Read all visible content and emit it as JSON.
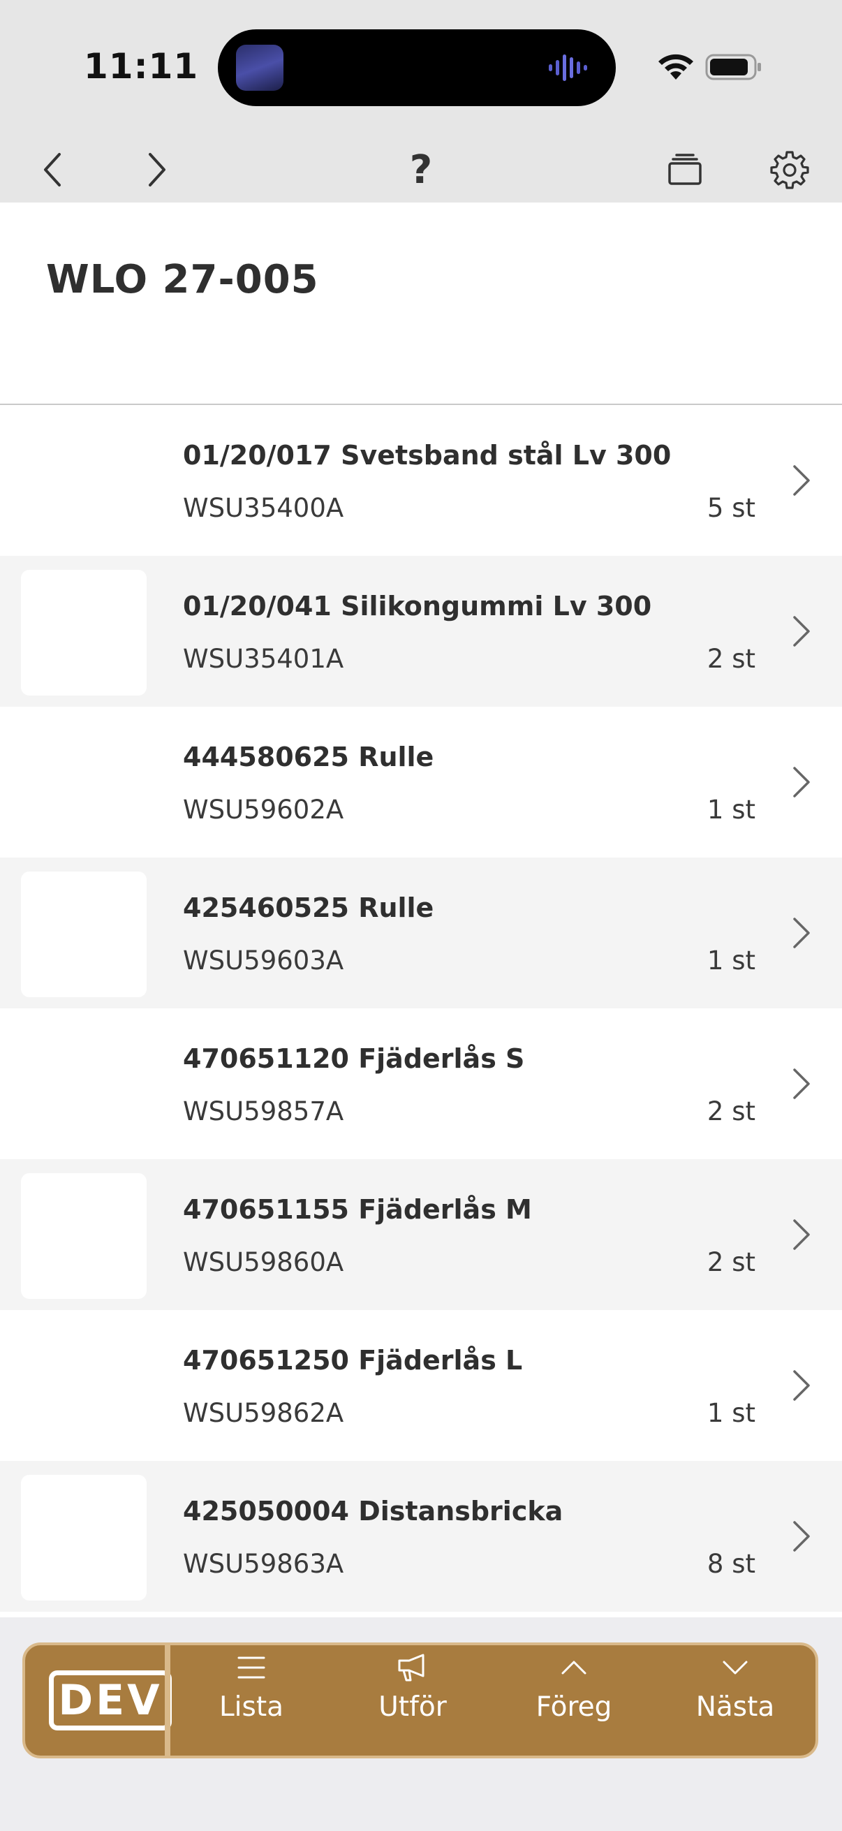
{
  "status_bar": {
    "time": "11:11"
  },
  "toolbar": {
    "help_label": "?"
  },
  "header": {
    "title": "WLO 27-005"
  },
  "items": [
    {
      "title": "01/20/017 Svetsband stål Lv 300",
      "code": "WSU35400A",
      "qty": "5 st"
    },
    {
      "title": "01/20/041 Silikongummi Lv 300",
      "code": "WSU35401A",
      "qty": "2 st"
    },
    {
      "title": "444580625 Rulle",
      "code": "WSU59602A",
      "qty": "1 st"
    },
    {
      "title": "425460525 Rulle",
      "code": "WSU59603A",
      "qty": "1 st"
    },
    {
      "title": "470651120 Fjäderlås S",
      "code": "WSU59857A",
      "qty": "2 st"
    },
    {
      "title": "470651155 Fjäderlås M",
      "code": "WSU59860A",
      "qty": "2 st"
    },
    {
      "title": "470651250 Fjäderlås L",
      "code": "WSU59862A",
      "qty": "1 st"
    },
    {
      "title": "425050004 Distansbricka",
      "code": "WSU59863A",
      "qty": "8 st"
    }
  ],
  "bottom_bar": {
    "logo_text": "DEV",
    "lista_label": "Lista",
    "utfor_label": "Utför",
    "foreg_label": "Föreg",
    "nasta_label": "Nästa"
  },
  "colors": {
    "bottom_bar": "#a87c3f",
    "bottom_bar_border": "#d9b98a",
    "toolbar_bg": "#e6e6e6",
    "row_alt_bg": "#f4f4f4"
  },
  "icons": {
    "back": "chevron-left-icon",
    "forward": "chevron-right-icon",
    "tabs": "stacked-windows-icon",
    "settings": "gear-icon",
    "lista": "list-icon",
    "utfor": "megaphone-icon",
    "foreg": "chevron-up-icon",
    "nasta": "chevron-down-icon"
  }
}
